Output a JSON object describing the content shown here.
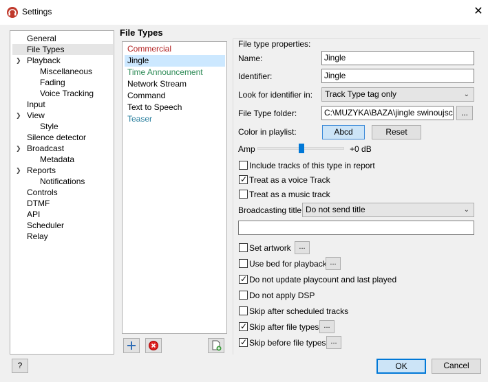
{
  "window": {
    "title": "Settings",
    "app_icon": "headphones-icon",
    "close_icon": "close-icon"
  },
  "tree": {
    "items": [
      {
        "label": "General"
      },
      {
        "label": "File Types"
      },
      {
        "label": "Playback"
      },
      {
        "label": "Miscellaneous"
      },
      {
        "label": "Fading"
      },
      {
        "label": "Voice Tracking"
      },
      {
        "label": "Input"
      },
      {
        "label": "View"
      },
      {
        "label": "Style"
      },
      {
        "label": "Silence detector"
      },
      {
        "label": "Broadcast"
      },
      {
        "label": "Metadata"
      },
      {
        "label": "Reports"
      },
      {
        "label": "Notifications"
      },
      {
        "label": "Controls"
      },
      {
        "label": "DTMF"
      },
      {
        "label": "API"
      },
      {
        "label": "Scheduler"
      },
      {
        "label": "Relay"
      }
    ]
  },
  "file_types": {
    "heading": "File Types",
    "items": [
      {
        "label": "Commercial",
        "color": "#b22222"
      },
      {
        "label": "Jingle",
        "color": "#000000"
      },
      {
        "label": "Time Announcement",
        "color": "#2e8b57"
      },
      {
        "label": "Network Stream",
        "color": "#000000"
      },
      {
        "label": "Command",
        "color": "#000000"
      },
      {
        "label": "Text to Speech",
        "color": "#000000"
      },
      {
        "label": "Teaser",
        "color": "#2a7f9e"
      }
    ],
    "add_icon": "plus-icon",
    "remove_icon": "remove-icon",
    "copy_icon": "copy-icon"
  },
  "props": {
    "group_title": "File type properties:",
    "name_label": "Name:",
    "name_value": "Jingle",
    "identifier_label": "Identifier:",
    "identifier_value": "Jingle",
    "look_label": "Look for identifier in:",
    "look_value": "Track Type tag only",
    "folder_label": "File Type folder:",
    "folder_value": "C:\\MUZYKA\\BAZA\\jingle swinoujscie\\SW",
    "folder_browse": "...",
    "color_label": "Color in playlist:",
    "color_sample": "Abcd",
    "reset_label": "Reset",
    "amp_label": "Amp",
    "amp_value": "+0 dB",
    "amp_level": 0.5,
    "cb_include": "Include tracks of this type in report",
    "cb_voice": "Treat as a voice Track",
    "cb_music": "Treat as a music track",
    "broadcast_title_label": "Broadcasting title:",
    "broadcast_title_value": "Do not send title",
    "cb_artwork": "Set artwork",
    "cb_bed": "Use bed for playback",
    "cb_playcount": "Do not update playcount and last played",
    "cb_dsp": "Do not apply DSP",
    "cb_skip_sched": "Skip after scheduled tracks",
    "cb_skip_after": "Skip after file types",
    "cb_skip_before": "Skip before file types",
    "dots": "...",
    "checks": {
      "include": false,
      "voice": true,
      "music": false,
      "artwork": false,
      "bed": false,
      "playcount": true,
      "dsp": false,
      "skip_sched": false,
      "skip_after": true,
      "skip_before": true
    }
  },
  "footer": {
    "help": "?",
    "ok": "OK",
    "cancel": "Cancel"
  }
}
